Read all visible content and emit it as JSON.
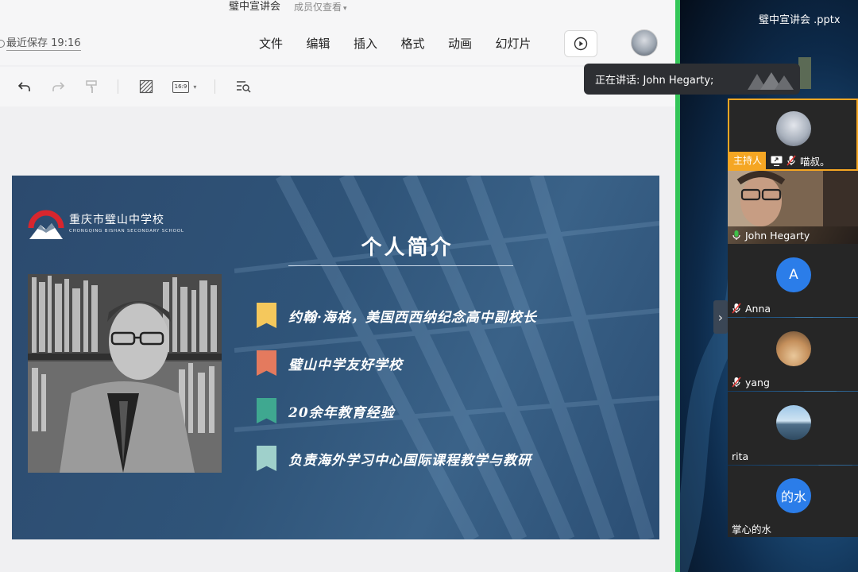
{
  "editor": {
    "doc_title": "璧中宣讲会",
    "permission": "成员仅查看",
    "save_status": "最近保存 19:16",
    "menu": [
      {
        "label": "文件"
      },
      {
        "label": "编辑"
      },
      {
        "label": "插入"
      },
      {
        "label": "格式"
      },
      {
        "label": "动画"
      },
      {
        "label": "幻灯片"
      }
    ],
    "toolbar": {
      "aspect_ratio": "16:9"
    }
  },
  "slide": {
    "school_name_cn": "重庆市璧山中学校",
    "school_name_en": "CHONGQING BISHAN SECONDARY SCHOOL",
    "title": "个人简介",
    "bullets": [
      {
        "text": "约翰·海格，美国西西纳纪念高中副校长",
        "color": "#f5c85c"
      },
      {
        "text": "璧山中学友好学校",
        "color": "#e47a5e"
      },
      {
        "text": "20余年教育经验",
        "color": "#3fa890"
      },
      {
        "text": "负责海外学习中心国际课程教学与教研",
        "color": "#9fd0cb"
      }
    ]
  },
  "meeting": {
    "file_title": "璧中宣讲会 .pptx",
    "speaking_label": "正在讲话: John Hegarty;",
    "host_badge": "主持人",
    "participants": [
      {
        "name": "喵叔。",
        "role": "host",
        "muted": true
      },
      {
        "name": "John Hegarty",
        "muted": false
      },
      {
        "name": "Anna",
        "initial": "A",
        "avatar_color": "#2b7de9",
        "muted": true
      },
      {
        "name": "yang",
        "muted": true
      },
      {
        "name": "rita",
        "muted": false
      },
      {
        "name": "掌心的水",
        "initial": "的水",
        "avatar_color": "#2b7de9",
        "muted": false
      }
    ]
  }
}
